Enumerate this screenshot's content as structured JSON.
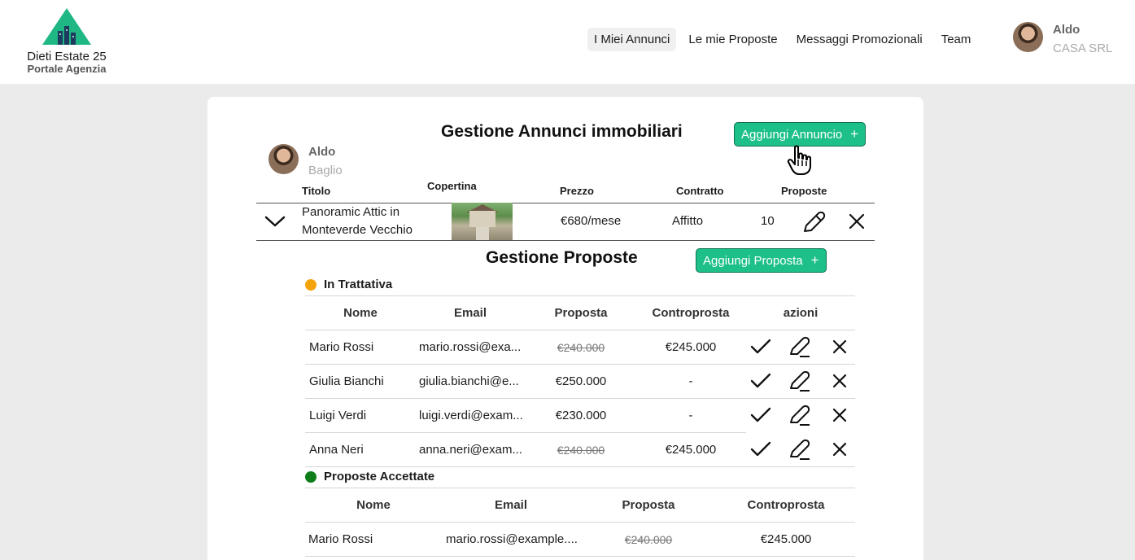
{
  "brand": {
    "name": "Dieti Estate 25",
    "subtitle": "Portale Agenzia"
  },
  "nav": [
    {
      "label": "I Miei Annunci",
      "active": true
    },
    {
      "label": "Le mie Proposte",
      "active": false
    },
    {
      "label": "Messaggi Promozionali",
      "active": false
    },
    {
      "label": "Team",
      "active": false
    }
  ],
  "user": {
    "name": "Aldo",
    "company": "CASA SRL"
  },
  "page": {
    "title": "Gestione Annunci immobiliari",
    "add_listing_label": "Aggiungi Annuncio",
    "add_icon": "+"
  },
  "owner": {
    "first_name": "Aldo",
    "last_name": "Baglio"
  },
  "listing_table": {
    "headers": {
      "title": "Titolo",
      "cover": "Copertina",
      "price": "Prezzo",
      "contract": "Contratto",
      "proposals": "Proposte"
    },
    "row": {
      "title_line1": "Panoramic Attic in",
      "title_line2": "Monteverde Vecchio",
      "price": "€680/mese",
      "contract": "Affitto",
      "proposals": "10"
    }
  },
  "proposals": {
    "title": "Gestione Proposte",
    "add_label": "Aggiungi Proposta",
    "negotiating": {
      "label": "In Trattativa",
      "color": "#f5a30a",
      "headers": {
        "name": "Nome",
        "email": "Email",
        "offer": "Proposta",
        "counter": "Controprosta",
        "actions": "azioni"
      },
      "rows": [
        {
          "name": "Mario Rossi",
          "email": "mario.rossi@exa...",
          "offer": "€240.000",
          "offer_struck": true,
          "counter": "€245.000"
        },
        {
          "name": "Giulia Bianchi",
          "email": "giulia.bianchi@e...",
          "offer": "€250.000",
          "offer_struck": false,
          "counter": "-"
        },
        {
          "name": "Luigi Verdi",
          "email": "luigi.verdi@exam...",
          "offer": "€230.000",
          "offer_struck": false,
          "counter": "-"
        },
        {
          "name": "Anna Neri",
          "email": "anna.neri@exam...",
          "offer": "€240.000",
          "offer_struck": true,
          "counter": "€245.000"
        }
      ]
    },
    "accepted": {
      "label": "Proposte Accettate",
      "color": "#0e7d1a",
      "headers": {
        "name": "Nome",
        "email": "Email",
        "offer": "Proposta",
        "counter": "Controprosta"
      },
      "rows": [
        {
          "name": "Mario Rossi",
          "email": "mario.rossi@example....",
          "offer": "€240.000",
          "offer_struck": true,
          "counter": "€245.000"
        }
      ]
    }
  },
  "colors": {
    "accent_green": "#1ec08a",
    "logo_green": "#1fb784",
    "logo_navy": "#1f3a5f"
  },
  "icons": {
    "expand": "chevron-down-icon",
    "edit": "pencil-icon",
    "delete": "close-icon",
    "accept": "check-icon",
    "cursor": "hand-pointer-icon"
  }
}
